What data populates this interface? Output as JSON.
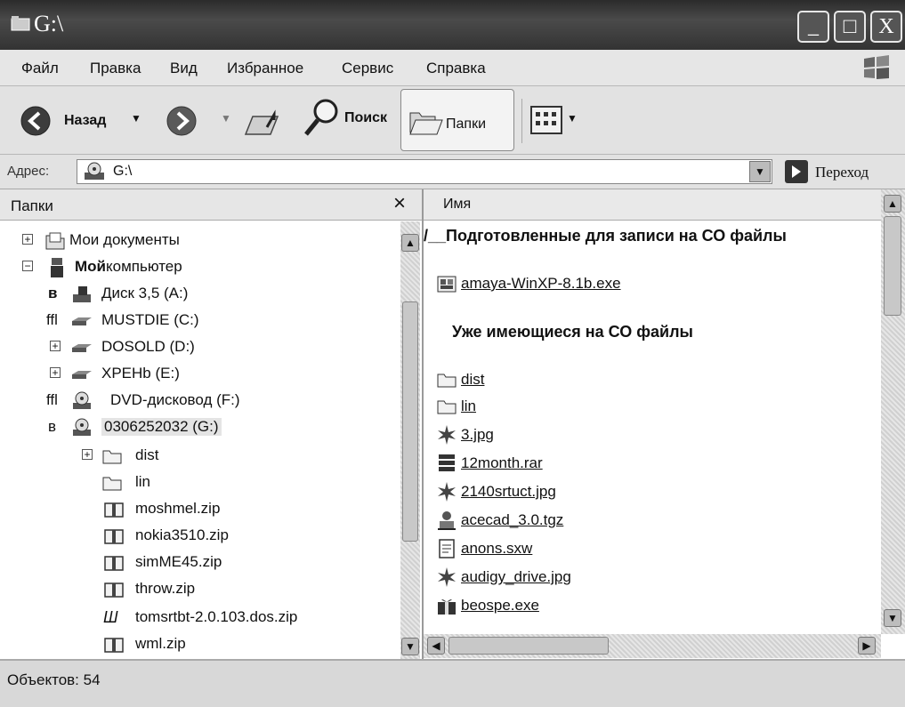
{
  "window": {
    "title": "G:\\",
    "minimize": "_",
    "maximize": "□",
    "close": "X"
  },
  "menu": [
    "Файл",
    "Правка",
    "Вид",
    "Избранное",
    "Сервис",
    "Справка"
  ],
  "toolbar": {
    "back": "Назад",
    "search": "Поиск",
    "folders": "Папки"
  },
  "address": {
    "label": "Адрес:",
    "value": "G:\\",
    "go": "Переход"
  },
  "folders_pane": {
    "title": "Папки",
    "close": "×",
    "tree": [
      {
        "expander": "+",
        "icon": "my-documents-icon",
        "label": "Мои документы"
      },
      {
        "expander": "−",
        "icon": "my-computer-icon",
        "label_bold": "Мой",
        "label": "компьютер"
      },
      {
        "mark": "в",
        "icon": "floppy-drive-icon",
        "label": "Диск 3,5 (A:)"
      },
      {
        "mark": "ffl",
        "icon": "hard-drive-icon",
        "label": "MUSTDIE (C:)"
      },
      {
        "expander": "+",
        "icon": "hard-drive-icon",
        "label": "DOSOLD (D:)"
      },
      {
        "expander": "+",
        "icon": "hard-drive-icon",
        "label": "XPEHb (E:)"
      },
      {
        "mark": "ffl",
        "icon": "dvd-drive-icon",
        "label": "DVD-дисковод (F:)"
      },
      {
        "mark": "в",
        "icon": "cd-drive-icon",
        "label": "0306252032 (G:)"
      },
      {
        "expander": "+",
        "icon": "folder-icon",
        "label": "dist"
      },
      {
        "icon": "folder-icon",
        "label": "lin"
      },
      {
        "icon": "zip-folder-icon",
        "label": "moshmel.zip"
      },
      {
        "icon": "zip-folder-icon",
        "label": "nokia3510.zip"
      },
      {
        "icon": "zip-folder-icon",
        "label": "simME45.zip"
      },
      {
        "icon": "zip-folder-icon",
        "label": "throw.zip"
      },
      {
        "mark": "Ш",
        "label": "tomsrtbt-2.0.103.dos.zip"
      },
      {
        "icon": "zip-folder-icon",
        "label": "wml.zip"
      }
    ]
  },
  "files_pane": {
    "column_name": "Имя",
    "group_pending": "/__Подготовленные для записи на СО файлы",
    "pending_files": [
      {
        "icon": "installer-icon",
        "name": "amaya-WinXP-8.1b.exe"
      }
    ],
    "group_existing": "Уже имеющиеся на СО файлы",
    "existing_files": [
      {
        "icon": "folder-icon",
        "name": "dist"
      },
      {
        "icon": "folder-icon",
        "name": "lin"
      },
      {
        "icon": "image-file-icon",
        "name": "3.jpg"
      },
      {
        "icon": "archive-file-icon",
        "name": "12month.rar"
      },
      {
        "icon": "image-file-icon",
        "name": "2140srtuct.jpg"
      },
      {
        "icon": "tgz-file-icon",
        "name": "acecad_3.0.tgz"
      },
      {
        "icon": "document-file-icon",
        "name": "anons.sxw"
      },
      {
        "icon": "image-file-icon",
        "name": "audigy_drive.jpg"
      },
      {
        "icon": "exe-package-icon",
        "name": "beospe.exe"
      }
    ]
  },
  "status": {
    "text": "Объектов: 54"
  }
}
